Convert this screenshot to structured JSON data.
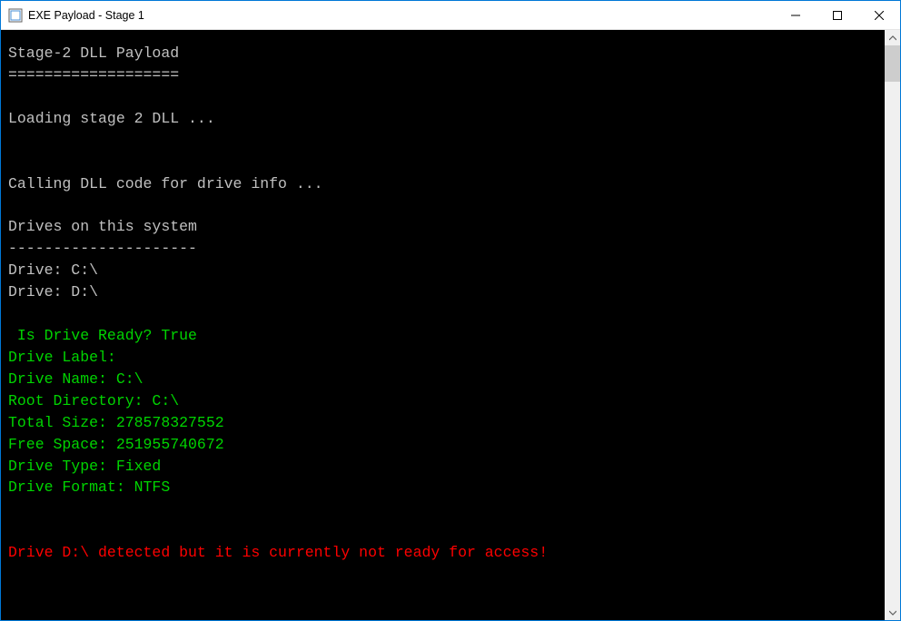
{
  "window": {
    "title": "EXE Payload - Stage 1"
  },
  "console": {
    "header_title": "Stage-2 DLL Payload",
    "header_sep": "===================",
    "loading_msg": "Loading stage 2 DLL ...",
    "calling_msg": "Calling DLL code for drive info ...",
    "drives_header": "Drives on this system",
    "drives_sep": "---------------------",
    "drive_c_line": "Drive: C:\\",
    "drive_d_line": "Drive: D:\\",
    "ready_line": " Is Drive Ready? True",
    "label_line": "Drive Label:",
    "name_line": "Drive Name: C:\\",
    "rootdir_line": "Root Directory: C:\\",
    "totalsize_line": "Total Size: 278578327552",
    "freespace_line": "Free Space: 251955740672",
    "drivetype_line": "Drive Type: Fixed",
    "driveformat_line": "Drive Format: NTFS",
    "warning_line": "Drive D:\\ detected but it is currently not ready for access!"
  }
}
